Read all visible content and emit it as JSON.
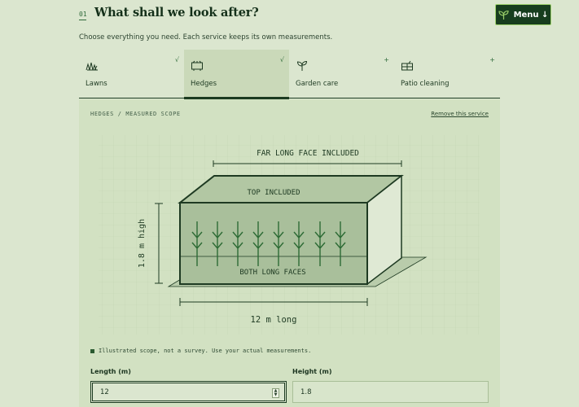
{
  "header": {
    "step_number": "01",
    "title": "What shall we look after?",
    "menu_label": "Menu ↓"
  },
  "subtitle": "Choose everything you need. Each service keeps its own measurements.",
  "tabs": [
    {
      "label": "Lawns",
      "mark": "√",
      "icon": "grass-icon",
      "selected": true,
      "active": false
    },
    {
      "label": "Hedges",
      "mark": "√",
      "icon": "hedge-icon",
      "selected": true,
      "active": true
    },
    {
      "label": "Garden care",
      "mark": "+",
      "icon": "sprout-icon",
      "selected": false,
      "active": false
    },
    {
      "label": "Patio cleaning",
      "mark": "+",
      "icon": "patio-icon",
      "selected": false,
      "active": false
    }
  ],
  "panel": {
    "scope_label": "HEDGES / MEASURED SCOPE",
    "remove_link": "Remove this service",
    "diagram": {
      "far_face_label": "FAR LONG FACE INCLUDED",
      "top_label": "TOP INCLUDED",
      "faces_label": "BOTH LONG FACES",
      "height_label": "1.8 m high",
      "length_label": "12 m long"
    },
    "note": "Illustrated scope, not a survey. Use your actual measurements.",
    "fields": {
      "length_label": "Length (m)",
      "length_value": "12",
      "height_label": "Height (m)",
      "height_value": "1.8"
    }
  },
  "colors": {
    "background": "#dbe6cf",
    "panel": "#d2e1c2",
    "accent_dark": "#173d1e",
    "accent_line": "#2f6a3a"
  }
}
